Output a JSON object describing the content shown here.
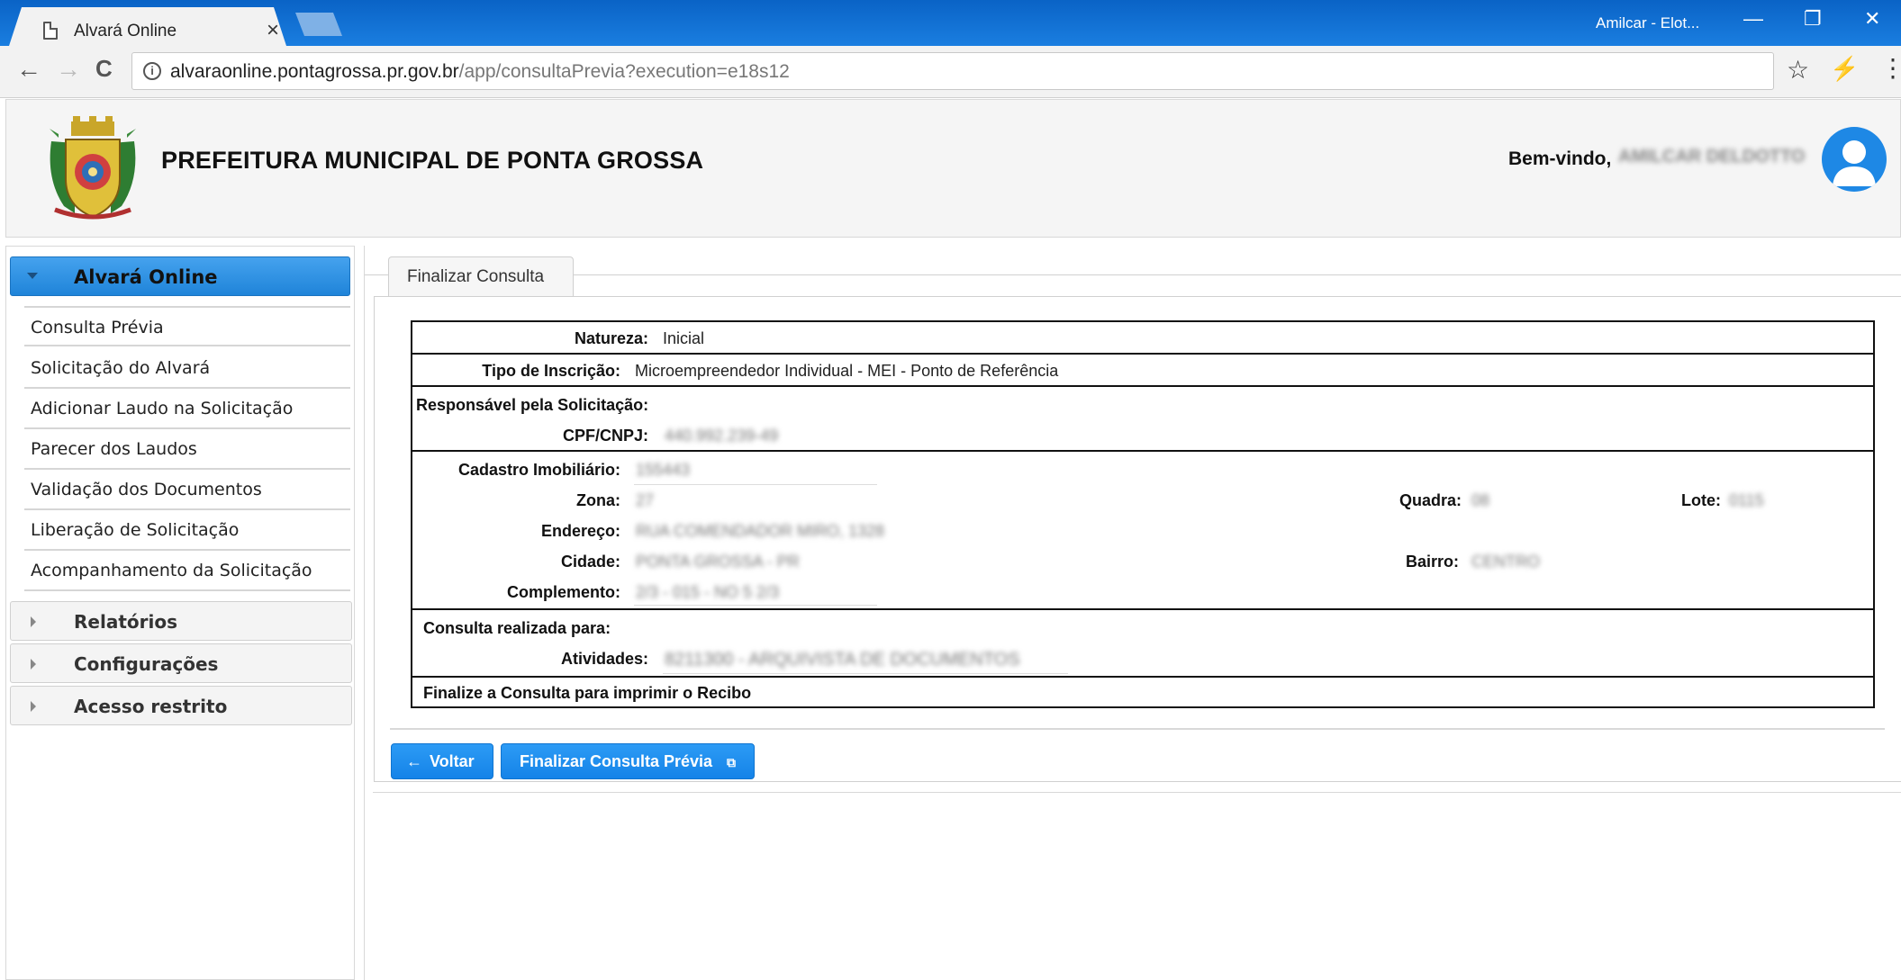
{
  "browser": {
    "tab_title": "Alvará Online",
    "tab_close": "×",
    "profile": "Amilcar - Elot...",
    "url_host": "alvaraonline.pontagrossa.pr.gov.br",
    "url_path": "/app/consultaPrevia?execution=e18s12",
    "btn_minimize": "—",
    "btn_restore": "❐",
    "btn_close": "✕",
    "back": "←",
    "forward": "→",
    "reload": "C",
    "info": "i",
    "star": "☆",
    "menu": "⋮"
  },
  "header": {
    "org_title": "PREFEITURA MUNICIPAL DE PONTA GROSSA",
    "welcome": "Bem-vindo,",
    "username": "AMILCAR DELDOTTO"
  },
  "sidebar": {
    "section_title": "Alvará Online",
    "items": [
      "Consulta Prévia",
      "Solicitação do Alvará",
      "Adicionar Laudo na Solicitação",
      "Parecer dos Laudos",
      "Validação dos Documentos",
      "Liberação de Solicitação",
      "Acompanhamento da Solicitação"
    ],
    "groups": [
      "Relatórios",
      "Configurações",
      "Acesso restrito"
    ]
  },
  "main": {
    "tab_label": "Finalizar Consulta",
    "natureza_label": "Natureza:",
    "natureza_value": "Inicial",
    "tipo_label": "Tipo de Inscrição:",
    "tipo_value": "Microempreendedor Individual - MEI - Ponto de Referência",
    "responsavel_label": "Responsável pela Solicitação:",
    "cpf_label": "CPF/CNPJ:",
    "cpf_value": "440.992.239-49",
    "cadastro_label": "Cadastro Imobiliário:",
    "cadastro_value": "155443",
    "zona_label": "Zona:",
    "zona_value": "27",
    "quadra_label": "Quadra:",
    "quadra_value": "08",
    "lote_label": "Lote:",
    "lote_value": "0115",
    "endereco_label": "Endereço:",
    "endereco_value": "RUA COMENDADOR MIRO, 1328",
    "cidade_label": "Cidade:",
    "cidade_value": "PONTA GROSSA - PR",
    "bairro_label": "Bairro:",
    "bairro_value": "CENTRO",
    "complemento_label": "Complemento:",
    "complemento_value": "2/3 - 015 - NO 5 2/3",
    "consulta_label": "Consulta realizada para:",
    "atividades_label": "Atividades:",
    "atividades_value": "8211300 - ARQUIVISTA DE DOCUMENTOS",
    "finalize_note": "Finalize a Consulta para imprimir o Recibo",
    "btn_voltar": "Voltar",
    "btn_finalizar": "Finalizar Consulta Prévia"
  },
  "colors": {
    "titlebar": "#0d6fd3",
    "accent": "#1e90ff",
    "sidebar_header": "#2d8fe0"
  }
}
